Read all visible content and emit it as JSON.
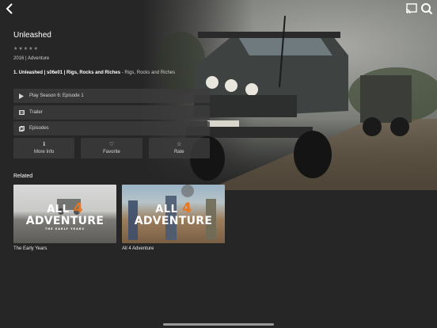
{
  "topbar": {
    "back_icon": "chevron-left-icon",
    "cast_icon": "cast-icon",
    "search_icon": "search-icon"
  },
  "show": {
    "title": "Unleashed",
    "rating_stars": "★★★★★",
    "meta": "2016 | Adventure",
    "episode_prefix": "1. Unleashed | s06e01 | Rigs, Rocks and Riches",
    "episode_sub": " - Rigs, Rocks and Riches"
  },
  "actions": {
    "play": "Play Season 6: Episode 1",
    "trailer": "Trailer",
    "episodes": "Episodes"
  },
  "tiles": {
    "more_info": "More Info",
    "favorite": "Favorite",
    "rate": "Rate"
  },
  "related": {
    "heading": "Related",
    "items": [
      {
        "caption": "The Early Years",
        "logo_top": "ALL",
        "logo_four": "4",
        "logo_bottom": "ADVENTURE",
        "logo_tag": "THE EARLY YEARS"
      },
      {
        "caption": "All 4 Adventure",
        "logo_top": "ALL",
        "logo_four": "4",
        "logo_bottom": "ADVENTURE",
        "logo_tag": ""
      }
    ]
  },
  "colors": {
    "background": "#262626",
    "accent_orange": "#e8761f",
    "panel": "#3c3c3c"
  }
}
